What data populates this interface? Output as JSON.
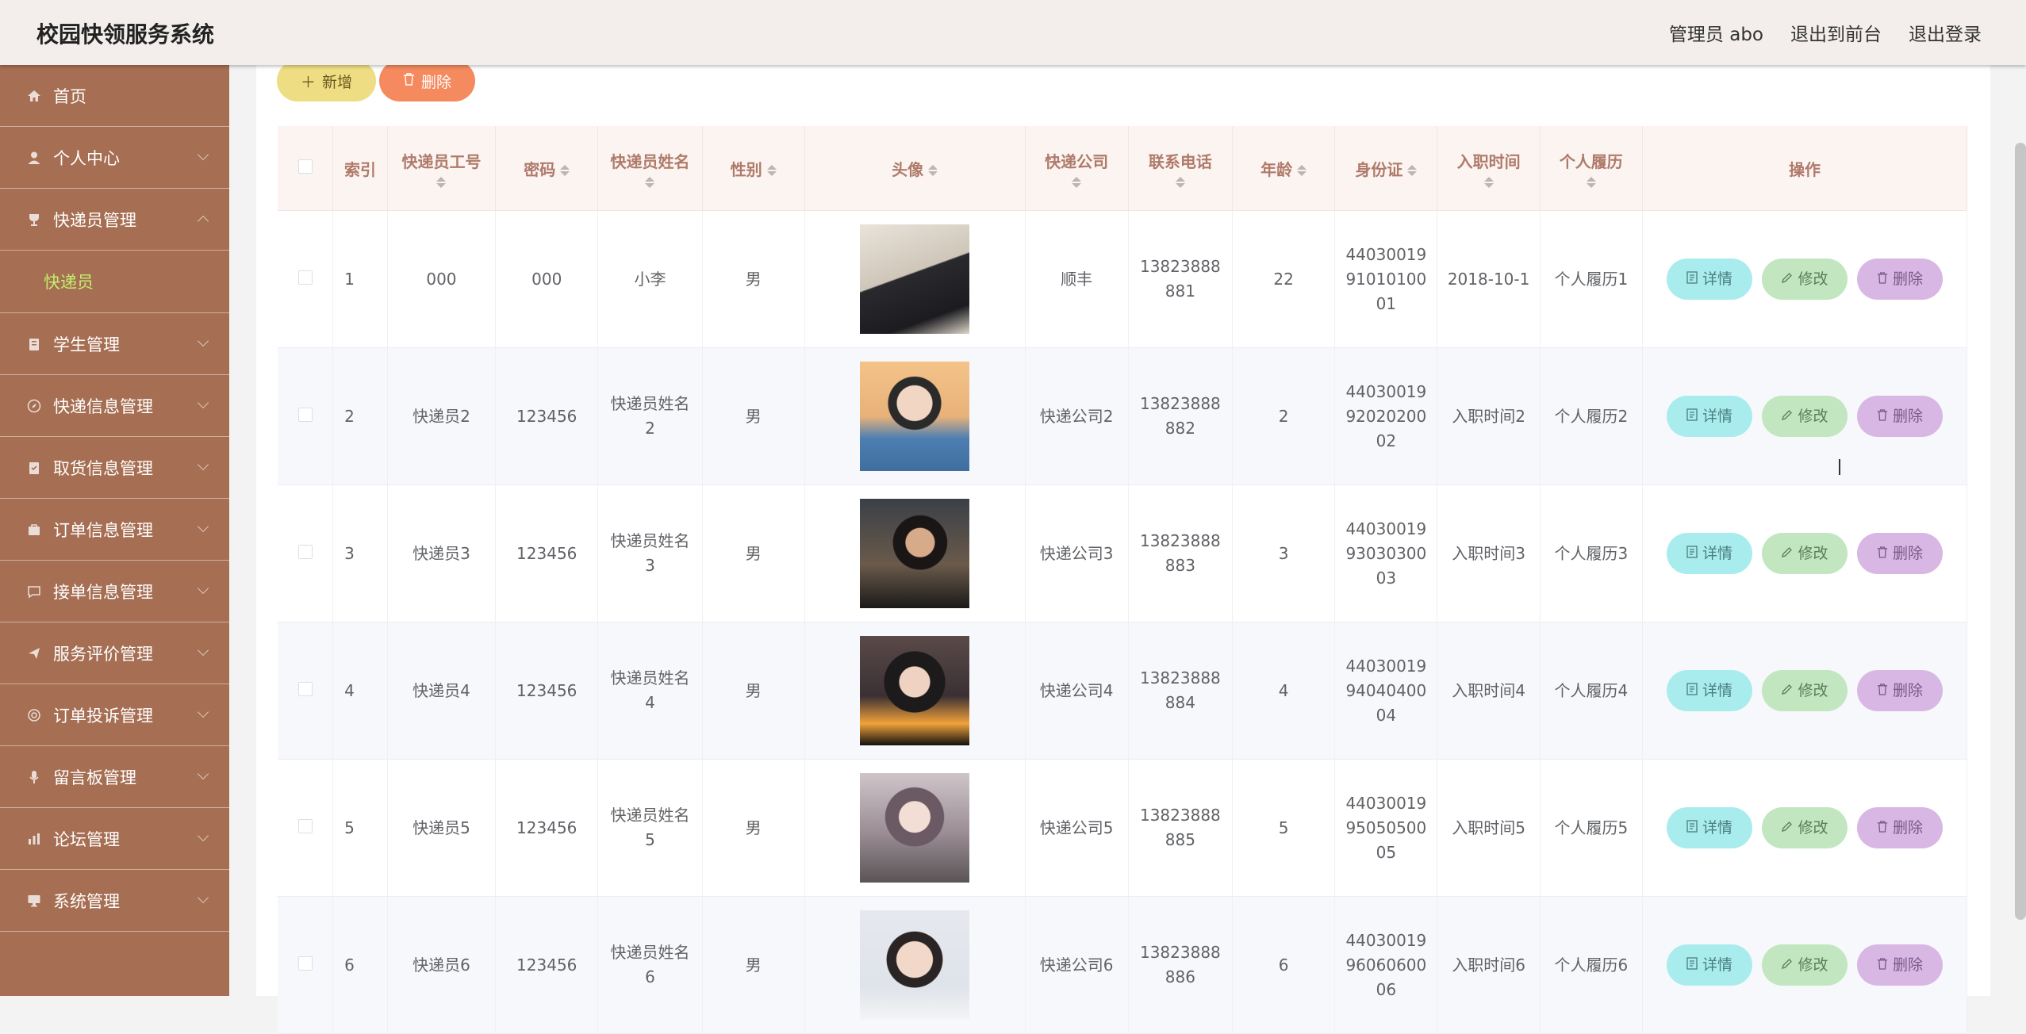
{
  "header": {
    "title": "校园快领服务系统",
    "admin_label": "管理员 abo",
    "to_front": "退出到前台",
    "logout": "退出登录"
  },
  "sidebar": {
    "items": [
      {
        "label": "首页",
        "icon": "home-icon"
      },
      {
        "label": "个人中心",
        "icon": "user-icon"
      },
      {
        "label": "快递员管理",
        "icon": "trophy-icon",
        "expanded": true
      },
      {
        "label": "学生管理",
        "icon": "clipboard-icon"
      },
      {
        "label": "快递信息管理",
        "icon": "compass-icon"
      },
      {
        "label": "取货信息管理",
        "icon": "note-icon"
      },
      {
        "label": "订单信息管理",
        "icon": "bag-icon"
      },
      {
        "label": "接单信息管理",
        "icon": "chat-icon"
      },
      {
        "label": "服务评价管理",
        "icon": "send-icon"
      },
      {
        "label": "订单投诉管理",
        "icon": "ring-icon"
      },
      {
        "label": "留言板管理",
        "icon": "mic-icon"
      },
      {
        "label": "论坛管理",
        "icon": "chart-icon"
      },
      {
        "label": "系统管理",
        "icon": "monitor-icon"
      }
    ],
    "sub_item": "快递员"
  },
  "toolbar": {
    "add_label": "新增",
    "delete_label": "删除"
  },
  "table": {
    "headers": [
      "索引",
      "快递员工号",
      "密码",
      "快递员姓名",
      "性别",
      "头像",
      "快递公司",
      "联系电话",
      "年龄",
      "身份证",
      "入职时间",
      "个人履历",
      "操作"
    ],
    "ops": {
      "detail": "详情",
      "edit": "修改",
      "delete": "删除"
    },
    "rows": [
      {
        "index": "1",
        "worker_id": "000",
        "password": "000",
        "name": "小李",
        "gender": "男",
        "company": "顺丰",
        "phone": "13823888881",
        "age": "22",
        "id_card": "440300199101010001",
        "join_time": "2018-10-1",
        "resume": "个人履历1"
      },
      {
        "index": "2",
        "worker_id": "快递员2",
        "password": "123456",
        "name": "快递员姓名2",
        "gender": "男",
        "company": "快递公司2",
        "phone": "13823888882",
        "age": "2",
        "id_card": "440300199202020002",
        "join_time": "入职时间2",
        "resume": "个人履历2"
      },
      {
        "index": "3",
        "worker_id": "快递员3",
        "password": "123456",
        "name": "快递员姓名3",
        "gender": "男",
        "company": "快递公司3",
        "phone": "13823888883",
        "age": "3",
        "id_card": "440300199303030003",
        "join_time": "入职时间3",
        "resume": "个人履历3"
      },
      {
        "index": "4",
        "worker_id": "快递员4",
        "password": "123456",
        "name": "快递员姓名4",
        "gender": "男",
        "company": "快递公司4",
        "phone": "13823888884",
        "age": "4",
        "id_card": "440300199404040004",
        "join_time": "入职时间4",
        "resume": "个人履历4"
      },
      {
        "index": "5",
        "worker_id": "快递员5",
        "password": "123456",
        "name": "快递员姓名5",
        "gender": "男",
        "company": "快递公司5",
        "phone": "13823888885",
        "age": "5",
        "id_card": "440300199505050005",
        "join_time": "入职时间5",
        "resume": "个人履历5"
      },
      {
        "index": "6",
        "worker_id": "快递员6",
        "password": "123456",
        "name": "快递员姓名6",
        "gender": "男",
        "company": "快递公司6",
        "phone": "13823888886",
        "age": "6",
        "id_card": "440300199606060006",
        "join_time": "入职时间6",
        "resume": "个人履历6"
      }
    ]
  },
  "colors": {
    "sidebar_bg": "#a66e52",
    "header_bg": "#f3eeec",
    "submenu_active": "#c2ef6e",
    "add_button": "#eedd83",
    "delete_button": "#f48a5e",
    "detail_button": "#a9ecee",
    "edit_button": "#c2e6bf",
    "row_delete_button": "#d9b7e5"
  }
}
